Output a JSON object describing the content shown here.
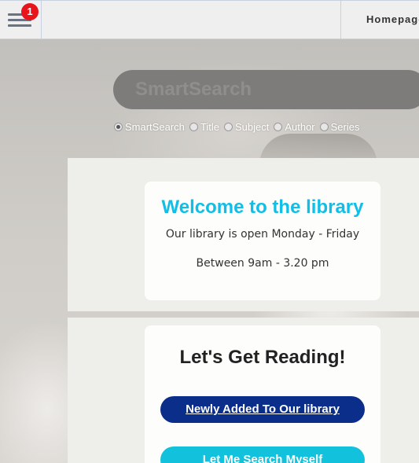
{
  "header": {
    "notification_count": "1",
    "homepage_label": "Homepage"
  },
  "search": {
    "placeholder": "SmartSearch",
    "options": [
      {
        "label": "SmartSearch",
        "checked": true
      },
      {
        "label": "Title",
        "checked": false
      },
      {
        "label": "Subject",
        "checked": false
      },
      {
        "label": "Author",
        "checked": false
      },
      {
        "label": "Series",
        "checked": false
      }
    ]
  },
  "welcome": {
    "title": "Welcome to the library",
    "line1": "Our library is open Monday - Friday",
    "line2": "Between 9am - 3.20 pm"
  },
  "reading": {
    "title": "Let's Get Reading!",
    "newly_added_label": "Newly Added To Our library",
    "search_myself_label": "Let Me Search Myself"
  },
  "colors": {
    "accent_cyan": "#0fbfe8",
    "button_navy": "#0a2e8a",
    "button_cyan": "#12c2dc",
    "badge_red": "#e8141b"
  }
}
